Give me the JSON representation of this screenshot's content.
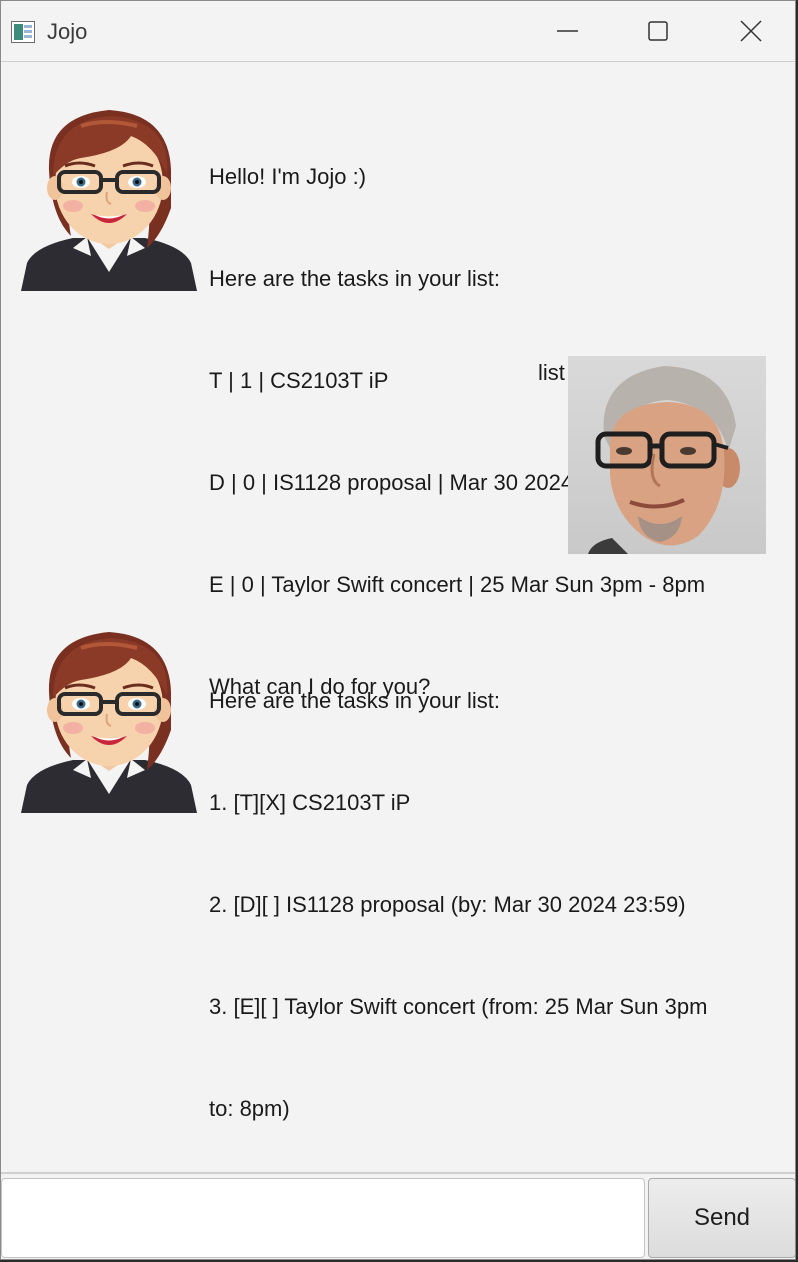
{
  "window": {
    "title": "Jojo"
  },
  "messages": [
    {
      "sender": "bot",
      "lines": [
        "Hello! I'm Jojo :)",
        "Here are the tasks in your list:",
        "T | 1 | CS2103T iP",
        "D | 0 | IS1128 proposal | Mar 30 2024 23:59",
        "E | 0 | Taylor Swift concert | 25 Mar Sun 3pm - 8pm",
        "What can I do for you?"
      ]
    },
    {
      "sender": "user",
      "text": "list"
    },
    {
      "sender": "bot",
      "lines": [
        "Here are the tasks in your list:",
        "1. [T][X] CS2103T iP",
        "2. [D][ ] IS1128 proposal (by: Mar 30 2024 23:59)",
        "3. [E][ ] Taylor Swift concert (from: 25 Mar Sun 3pm",
        "to: 8pm)"
      ]
    }
  ],
  "input": {
    "value": "",
    "placeholder": ""
  },
  "send_button": {
    "label": "Send"
  },
  "icons": {
    "app": "app-window-icon",
    "minimize": "minimize-icon",
    "maximize": "maximize-icon",
    "close": "close-icon",
    "bot_avatar": "woman-with-glasses-avatar",
    "user_avatar": "man-with-glasses-photo"
  },
  "colors": {
    "window_bg": "#f3f3f3",
    "text": "#1a1a1a",
    "send_button_bg": "#e4e4e4"
  }
}
